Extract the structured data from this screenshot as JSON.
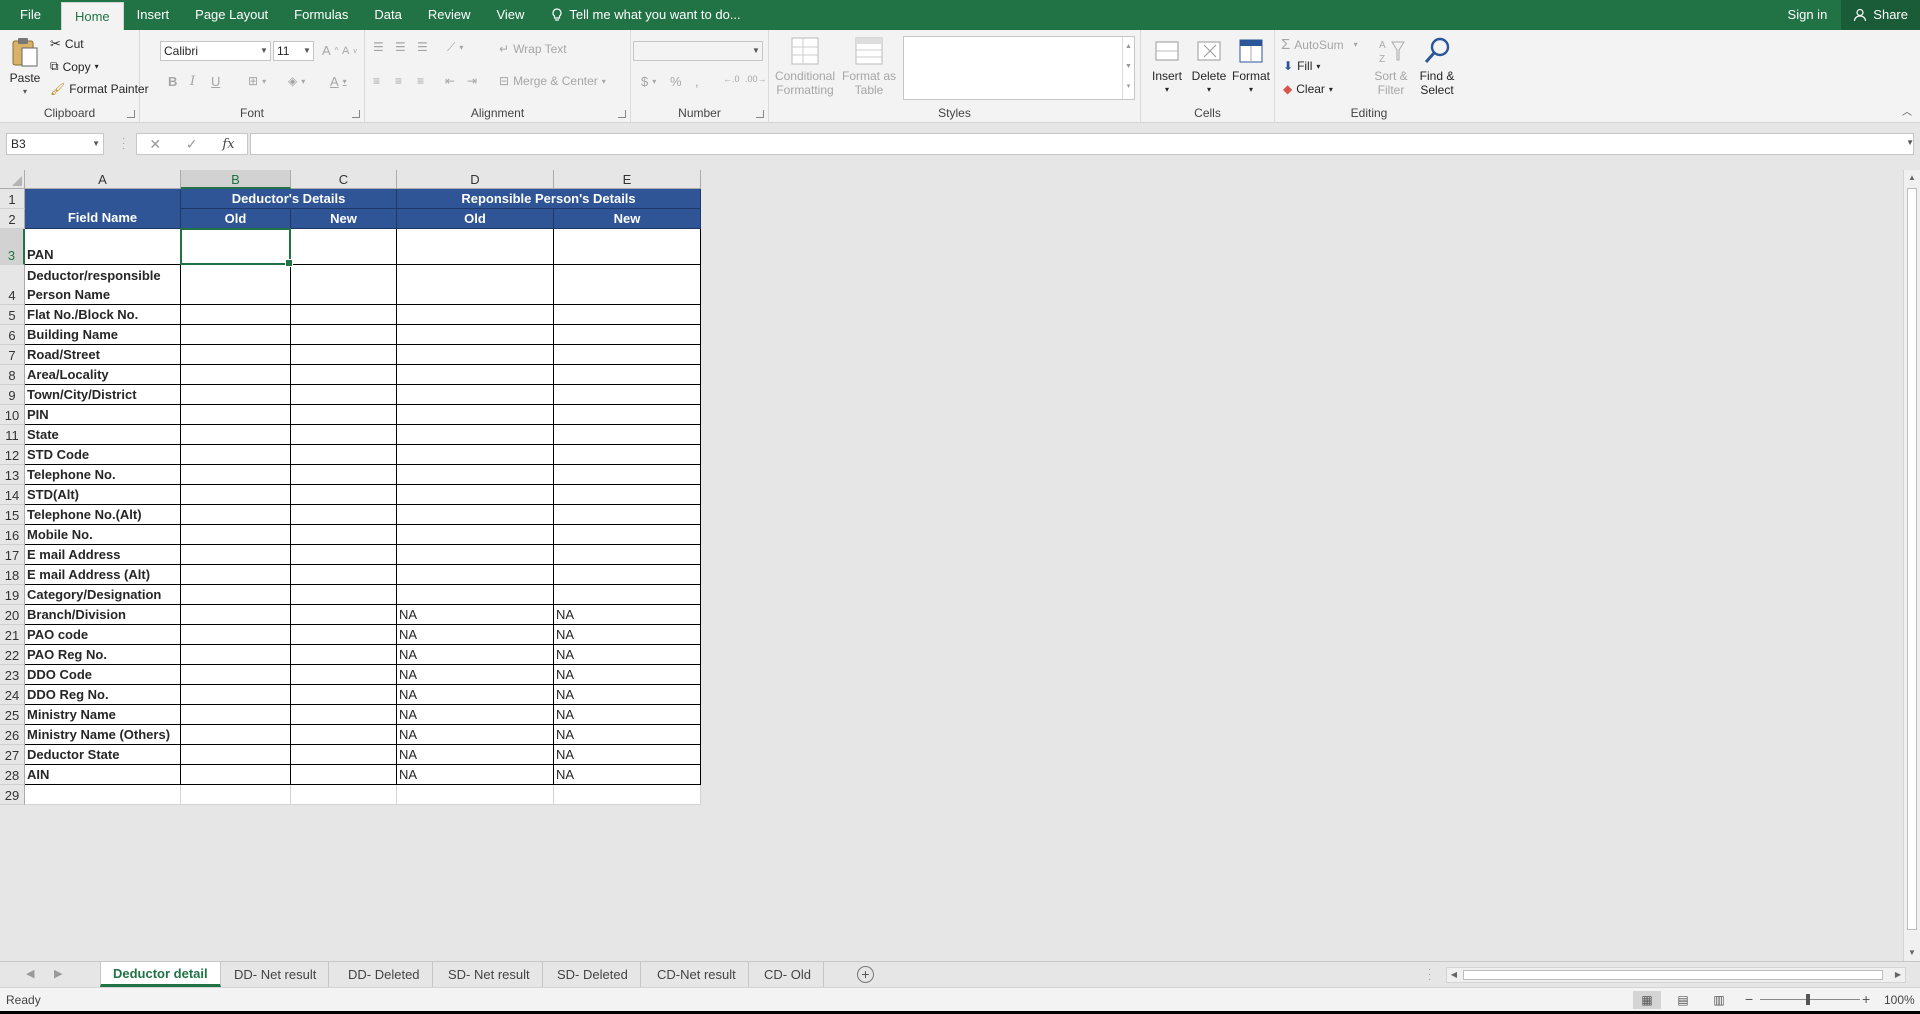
{
  "menu": {
    "tabs": [
      "File",
      "Home",
      "Insert",
      "Page Layout",
      "Formulas",
      "Data",
      "Review",
      "View"
    ],
    "active_tab": "Home",
    "tell_me": "Tell me what you want to do...",
    "sign_in": "Sign in",
    "share": "Share"
  },
  "ribbon": {
    "clipboard": {
      "label": "Clipboard",
      "paste": "Paste",
      "cut": "Cut",
      "copy": "Copy",
      "format_painter": "Format Painter"
    },
    "font": {
      "label": "Font",
      "font_name": "Calibri",
      "font_size": "11",
      "bold": "B",
      "italic": "I",
      "underline": "U",
      "grow": "A",
      "shrink": "A",
      "font_color": "A"
    },
    "alignment": {
      "label": "Alignment",
      "wrap_text": "Wrap Text",
      "merge_center": "Merge & Center"
    },
    "number": {
      "label": "Number",
      "format_value": "",
      "currency": "$",
      "percent": "%",
      "comma": ","
    },
    "styles": {
      "label": "Styles",
      "conditional_formatting_1": "Conditional",
      "conditional_formatting_2": "Formatting",
      "format_as_table_1": "Format as",
      "format_as_table_2": "Table"
    },
    "cells": {
      "label": "Cells",
      "insert": "Insert",
      "delete": "Delete",
      "format": "Format"
    },
    "editing": {
      "label": "Editing",
      "autosum": "AutoSum",
      "fill": "Fill",
      "clear": "Clear",
      "sort_filter_1": "Sort &",
      "sort_filter_2": "Filter",
      "find_select_1": "Find &",
      "find_select_2": "Select"
    }
  },
  "formula_bar": {
    "name_box": "B3",
    "formula": ""
  },
  "columns": [
    "A",
    "B",
    "C",
    "D",
    "E"
  ],
  "selected_column": "B",
  "selected_row": "3",
  "rows": [
    "1",
    "2",
    "3",
    "4",
    "5",
    "6",
    "7",
    "8",
    "9",
    "10",
    "11",
    "12",
    "13",
    "14",
    "15",
    "16",
    "17",
    "18",
    "19",
    "20",
    "21",
    "22",
    "23",
    "24",
    "25",
    "26",
    "27",
    "28",
    "29"
  ],
  "header": {
    "deductor_details": "Deductor's Details",
    "responsible_details": "Reponsible Person's Details",
    "field_name": "Field Name",
    "old_b": "Old",
    "new_c": "New",
    "old_d": "Old",
    "new_e": "New"
  },
  "fields": [
    {
      "name": "PAN",
      "d": "",
      "e": ""
    },
    {
      "name": "Deductor/responsible Person Name",
      "d": "",
      "e": ""
    },
    {
      "name": "Flat No./Block No.",
      "d": "",
      "e": ""
    },
    {
      "name": "Building Name",
      "d": "",
      "e": ""
    },
    {
      "name": "Road/Street",
      "d": "",
      "e": ""
    },
    {
      "name": "Area/Locality",
      "d": "",
      "e": ""
    },
    {
      "name": "Town/City/District",
      "d": "",
      "e": ""
    },
    {
      "name": "PIN",
      "d": "",
      "e": ""
    },
    {
      "name": "State",
      "d": "",
      "e": ""
    },
    {
      "name": "STD Code",
      "d": "",
      "e": ""
    },
    {
      "name": "Telephone No.",
      "d": "",
      "e": ""
    },
    {
      "name": "STD(Alt)",
      "d": "",
      "e": ""
    },
    {
      "name": "Telephone No.(Alt)",
      "d": "",
      "e": ""
    },
    {
      "name": "Mobile No.",
      "d": "",
      "e": ""
    },
    {
      "name": "E mail Address",
      "d": "",
      "e": ""
    },
    {
      "name": "E mail Address (Alt)",
      "d": "",
      "e": ""
    },
    {
      "name": "Category/Designation",
      "d": "",
      "e": ""
    },
    {
      "name": "Branch/Division",
      "d": "NA",
      "e": "NA"
    },
    {
      "name": "PAO code",
      "d": "NA",
      "e": "NA"
    },
    {
      "name": "PAO Reg No.",
      "d": "NA",
      "e": "NA"
    },
    {
      "name": "DDO Code",
      "d": "NA",
      "e": "NA"
    },
    {
      "name": "DDO Reg No.",
      "d": "NA",
      "e": "NA"
    },
    {
      "name": "Ministry Name",
      "d": "NA",
      "e": "NA"
    },
    {
      "name": "Ministry Name (Others)",
      "d": "NA",
      "e": "NA"
    },
    {
      "name": "Deductor State",
      "d": "NA",
      "e": "NA"
    },
    {
      "name": "AIN",
      "d": "NA",
      "e": "NA"
    }
  ],
  "sheet_tabs": [
    "Deductor detail",
    "DD- Net result",
    "DD- Deleted",
    "SD- Net result",
    "SD- Deleted",
    "CD-Net result",
    "CD- Old"
  ],
  "active_sheet": "Deductor detail",
  "status": {
    "ready": "Ready",
    "zoom": "100%"
  },
  "colors": {
    "accent": "#217346",
    "header_fill": "#2f5597"
  }
}
